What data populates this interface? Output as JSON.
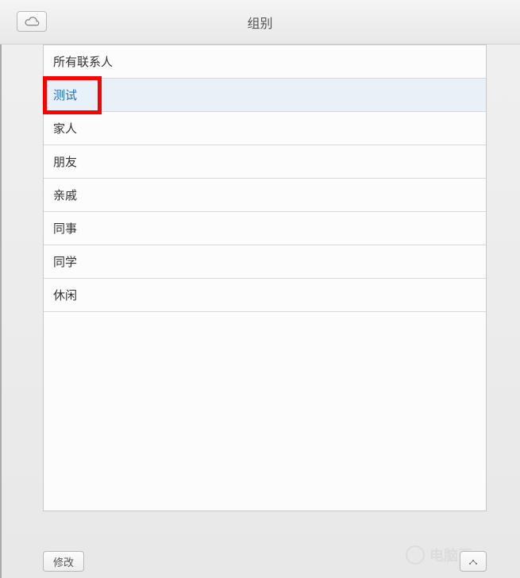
{
  "header": {
    "title": "组别"
  },
  "groups": [
    {
      "label": "所有联系人",
      "selected": false
    },
    {
      "label": "测试",
      "selected": true
    },
    {
      "label": "家人",
      "selected": false
    },
    {
      "label": "朋友",
      "selected": false
    },
    {
      "label": "亲戚",
      "selected": false
    },
    {
      "label": "同事",
      "selected": false
    },
    {
      "label": "同学",
      "selected": false
    },
    {
      "label": "休闲",
      "selected": false
    }
  ],
  "footer": {
    "edit_label": "修改"
  },
  "watermark": {
    "text": "电脑百"
  }
}
